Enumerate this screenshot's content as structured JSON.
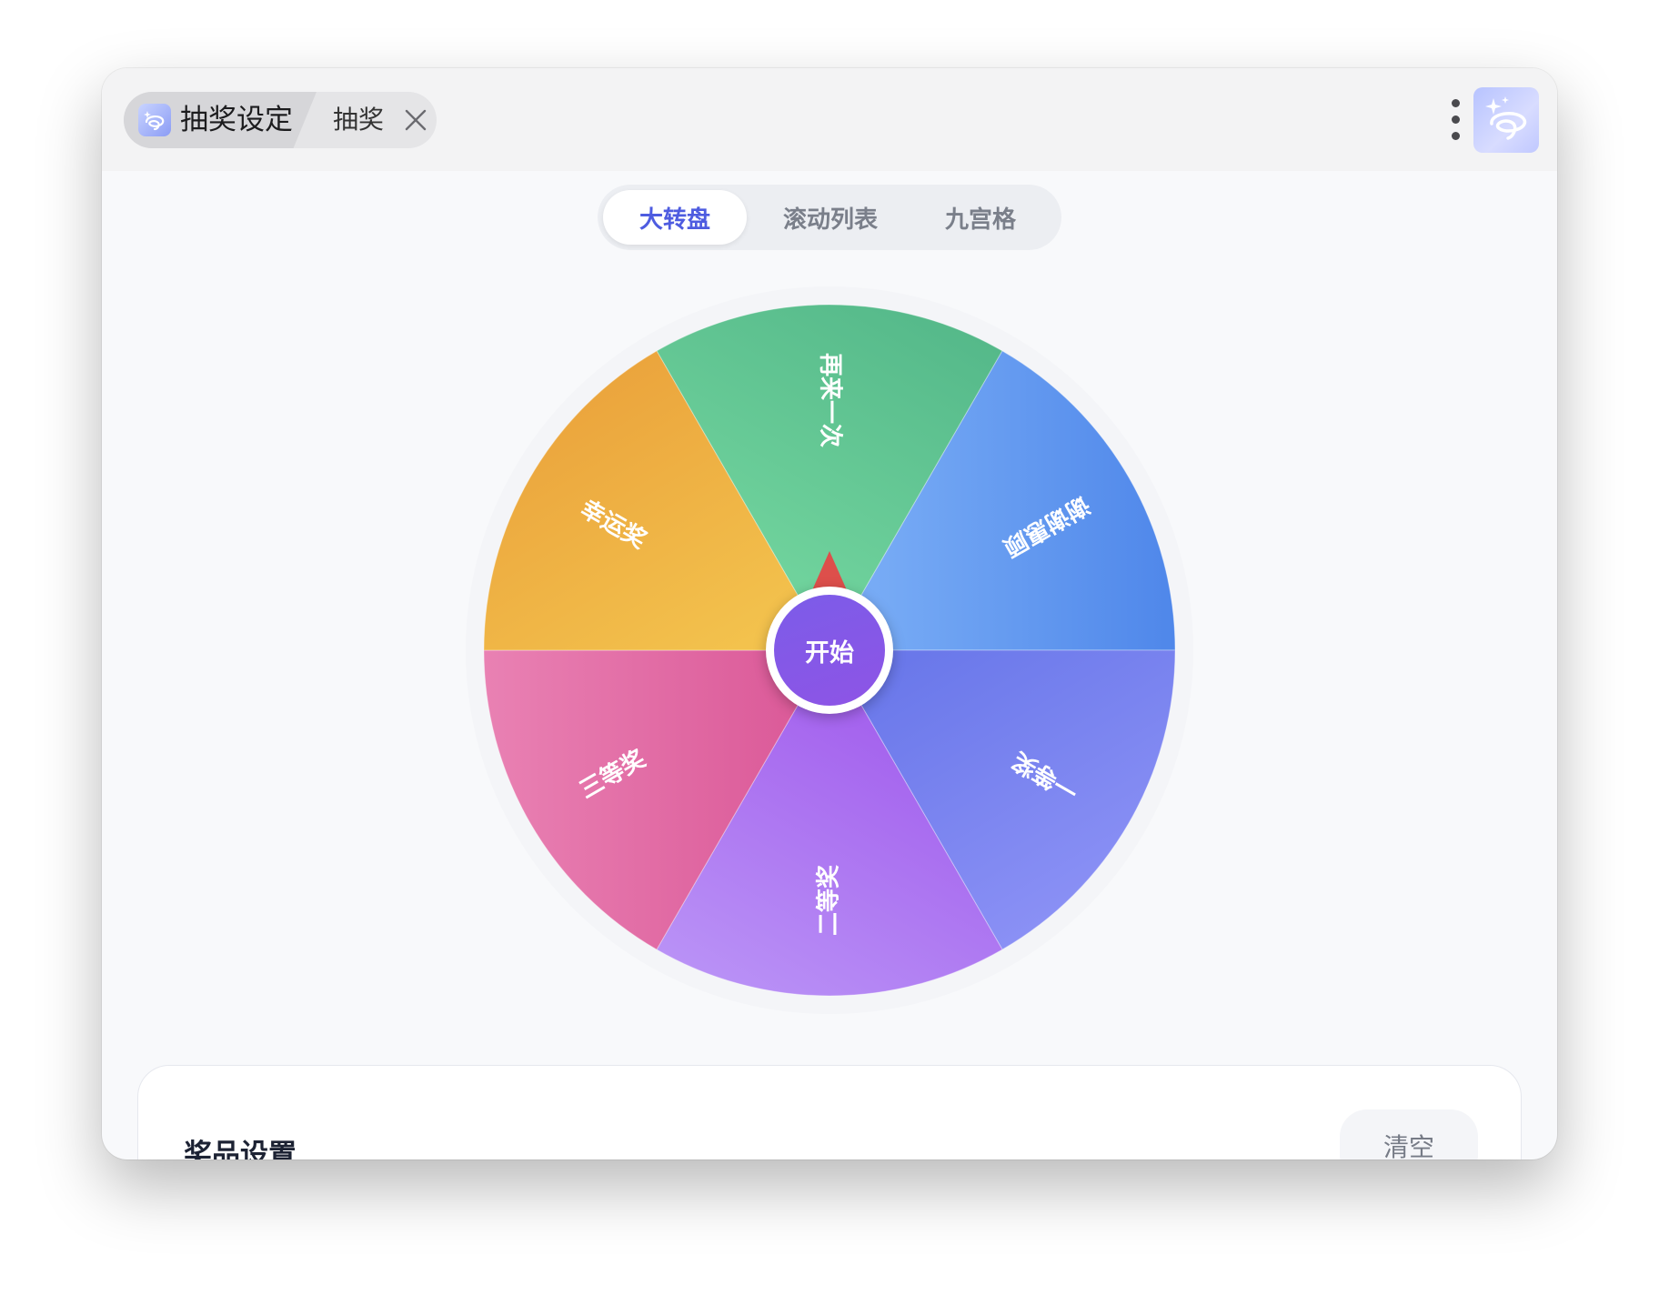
{
  "titlebar": {
    "active_tab_label": "抽奖设定",
    "second_tab_label": "抽奖"
  },
  "modes": {
    "items": [
      "大转盘",
      "滚动列表",
      "九宫格"
    ],
    "selected": "大转盘"
  },
  "wheel": {
    "start_label": "开始",
    "segments": [
      {
        "label": "再来一次",
        "color_from": "#6fd29c",
        "color_to": "#55b98a"
      },
      {
        "label": "谢谢惠顾",
        "color_from": "#77abf5",
        "color_to": "#4f87ea"
      },
      {
        "label": "一等奖",
        "color_from": "#6a78ea",
        "color_to": "#8a90f5"
      },
      {
        "label": "二等奖",
        "color_from": "#a564ee",
        "color_to": "#b991f6"
      },
      {
        "label": "三等奖",
        "color_from": "#dc5c9a",
        "color_to": "#e981b3"
      },
      {
        "label": "幸运奖",
        "color_from": "#f3c24d",
        "color_to": "#eba53d"
      }
    ],
    "pointer_color": "#dd4f4b"
  },
  "prize_settings": {
    "title": "奖品设置",
    "clear_label": "清空"
  },
  "icons": {
    "app": "sparkle-lasso-icon",
    "close": "close-icon",
    "menu": "vertical-dots-icon"
  }
}
